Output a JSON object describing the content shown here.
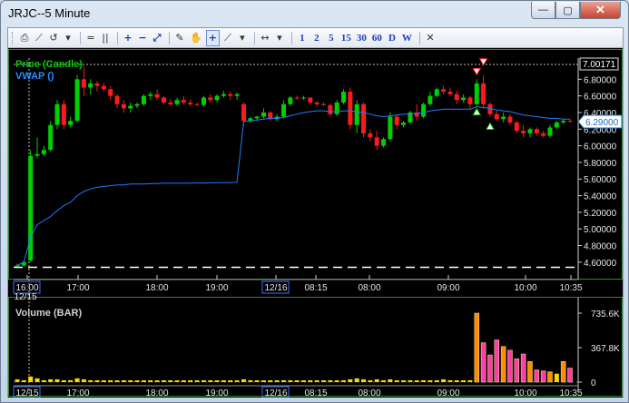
{
  "window": {
    "title": "JRJC--5 Minute",
    "minimize_label": "—",
    "maximize_label": "▢",
    "close_label": "✕"
  },
  "toolbar": {
    "items": [
      {
        "name": "print-icon",
        "glyph": "⎙"
      },
      {
        "name": "line-chart-icon",
        "glyph": "⟋"
      },
      {
        "name": "undo-icon",
        "glyph": "↺"
      },
      {
        "name": "dropdown-icon",
        "glyph": "▾"
      },
      {
        "name": "equals-icon",
        "glyph": "="
      },
      {
        "name": "pause-icon",
        "glyph": "||"
      },
      {
        "name": "zoom-in-icon",
        "glyph": "+"
      },
      {
        "name": "zoom-out-icon",
        "glyph": "−"
      },
      {
        "name": "fit-icon",
        "glyph": "⤢"
      },
      {
        "name": "draw-pen-icon",
        "glyph": "✎"
      },
      {
        "name": "hand-pan-icon",
        "glyph": "✋"
      },
      {
        "name": "crosshair-icon",
        "glyph": "+"
      },
      {
        "name": "trendline-icon",
        "glyph": "⟋"
      },
      {
        "name": "dropdown-icon",
        "glyph": "▾"
      },
      {
        "name": "scroll-both-icon",
        "glyph": "↔"
      },
      {
        "name": "dropdown-icon",
        "glyph": "▾"
      }
    ],
    "intervals": [
      "1",
      "2",
      "5",
      "15",
      "30",
      "60",
      "D",
      "W"
    ],
    "close_glyph": "✕"
  },
  "price_panel": {
    "legend_price": "Price (Candle)",
    "legend_vwap": "VWAP ()",
    "price_ticks": [
      "6.80000",
      "6.60000",
      "6.40000",
      "6.20000",
      "6.00000",
      "5.80000",
      "5.60000",
      "5.40000",
      "5.20000",
      "5.00000",
      "4.80000",
      "4.60000"
    ],
    "high_marker": "7.00171",
    "last_price": "6.29000",
    "colors": {
      "up": "#00d000",
      "down": "#ff1a1a",
      "vwap": "#1e7fff",
      "axis": "#e6e6e6",
      "legend_price": "#00d000",
      "legend_vwap": "#1e90ff",
      "last_price_bg": "#ffffff",
      "last_price_fg": "#1e6fd0"
    }
  },
  "volume_panel": {
    "legend": "Volume (BAR)",
    "ticks": [
      "735.6K",
      "367.8K",
      "0"
    ]
  },
  "time_axis": {
    "price_labels": [
      {
        "text": "16:00",
        "boxed": true
      },
      {
        "text": "17:00"
      },
      {
        "text": "18:00"
      },
      {
        "text": "19:00"
      },
      {
        "text": "12/16",
        "boxed": true
      },
      {
        "text": "08:15"
      },
      {
        "text": "08:00"
      },
      {
        "text": "09:00"
      },
      {
        "text": "10:00"
      },
      {
        "text": "10:35"
      }
    ],
    "start_date_label": "12/15",
    "volume_labels": [
      {
        "text": "12/15",
        "boxed": true
      },
      {
        "text": "17:00"
      },
      {
        "text": "18:00"
      },
      {
        "text": "19:00"
      },
      {
        "text": "12/16",
        "boxed": true
      },
      {
        "text": "08:15"
      },
      {
        "text": "08:00"
      },
      {
        "text": "09:00"
      },
      {
        "text": "10:00"
      },
      {
        "text": "10:35"
      }
    ]
  },
  "chart_data": {
    "type": "candlestick",
    "yaxis": {
      "min": 4.5,
      "max": 7.0
    },
    "volume_yaxis": {
      "min": 0,
      "max": 735600
    },
    "candles": [
      {
        "o": 4.55,
        "h": 4.58,
        "l": 4.55,
        "c": 4.56
      },
      {
        "o": 4.56,
        "h": 4.62,
        "l": 4.55,
        "c": 4.6
      },
      {
        "o": 4.62,
        "h": 5.95,
        "l": 4.6,
        "c": 5.88
      },
      {
        "o": 5.88,
        "h": 6.1,
        "l": 5.85,
        "c": 5.9
      },
      {
        "o": 5.9,
        "h": 6.0,
        "l": 5.88,
        "c": 5.95
      },
      {
        "o": 5.95,
        "h": 6.3,
        "l": 5.93,
        "c": 6.25
      },
      {
        "o": 6.25,
        "h": 6.55,
        "l": 6.2,
        "c": 6.5
      },
      {
        "o": 6.5,
        "h": 6.55,
        "l": 6.2,
        "c": 6.25
      },
      {
        "o": 6.25,
        "h": 6.35,
        "l": 6.22,
        "c": 6.3
      },
      {
        "o": 6.3,
        "h": 6.85,
        "l": 6.28,
        "c": 6.8
      },
      {
        "o": 6.8,
        "h": 6.96,
        "l": 6.6,
        "c": 6.7
      },
      {
        "o": 6.7,
        "h": 6.8,
        "l": 6.62,
        "c": 6.75
      },
      {
        "o": 6.75,
        "h": 6.78,
        "l": 6.65,
        "c": 6.72
      },
      {
        "o": 6.72,
        "h": 6.76,
        "l": 6.65,
        "c": 6.68
      },
      {
        "o": 6.68,
        "h": 6.72,
        "l": 6.55,
        "c": 6.6
      },
      {
        "o": 6.6,
        "h": 6.62,
        "l": 6.45,
        "c": 6.5
      },
      {
        "o": 6.5,
        "h": 6.55,
        "l": 6.4,
        "c": 6.45
      },
      {
        "o": 6.45,
        "h": 6.52,
        "l": 6.4,
        "c": 6.48
      },
      {
        "o": 6.48,
        "h": 6.52,
        "l": 6.45,
        "c": 6.5
      },
      {
        "o": 6.5,
        "h": 6.62,
        "l": 6.48,
        "c": 6.6
      },
      {
        "o": 6.6,
        "h": 6.65,
        "l": 6.55,
        "c": 6.62
      },
      {
        "o": 6.62,
        "h": 6.68,
        "l": 6.55,
        "c": 6.58
      },
      {
        "o": 6.58,
        "h": 6.6,
        "l": 6.5,
        "c": 6.52
      },
      {
        "o": 6.52,
        "h": 6.56,
        "l": 6.48,
        "c": 6.5
      },
      {
        "o": 6.5,
        "h": 6.58,
        "l": 6.48,
        "c": 6.55
      },
      {
        "o": 6.55,
        "h": 6.6,
        "l": 6.5,
        "c": 6.52
      },
      {
        "o": 6.52,
        "h": 6.56,
        "l": 6.48,
        "c": 6.5
      },
      {
        "o": 6.5,
        "h": 6.52,
        "l": 6.48,
        "c": 6.49
      },
      {
        "o": 6.49,
        "h": 6.6,
        "l": 6.47,
        "c": 6.58
      },
      {
        "o": 6.58,
        "h": 6.62,
        "l": 6.52,
        "c": 6.55
      },
      {
        "o": 6.55,
        "h": 6.62,
        "l": 6.52,
        "c": 6.6
      },
      {
        "o": 6.6,
        "h": 6.66,
        "l": 6.58,
        "c": 6.62
      },
      {
        "o": 6.62,
        "h": 6.65,
        "l": 6.55,
        "c": 6.6
      },
      {
        "o": 6.6,
        "h": 6.64,
        "l": 6.55,
        "c": 6.62
      },
      {
        "o": 6.5,
        "h": 6.52,
        "l": 6.25,
        "c": 6.3
      },
      {
        "o": 6.3,
        "h": 6.35,
        "l": 6.28,
        "c": 6.33
      },
      {
        "o": 6.33,
        "h": 6.36,
        "l": 6.3,
        "c": 6.35
      },
      {
        "o": 6.35,
        "h": 6.45,
        "l": 6.33,
        "c": 6.4
      },
      {
        "o": 6.4,
        "h": 6.42,
        "l": 6.3,
        "c": 6.32
      },
      {
        "o": 6.32,
        "h": 6.38,
        "l": 6.3,
        "c": 6.35
      },
      {
        "o": 6.35,
        "h": 6.55,
        "l": 6.33,
        "c": 6.5
      },
      {
        "o": 6.5,
        "h": 6.6,
        "l": 6.48,
        "c": 6.58
      },
      {
        "o": 6.58,
        "h": 6.6,
        "l": 6.55,
        "c": 6.57
      },
      {
        "o": 6.57,
        "h": 6.6,
        "l": 6.55,
        "c": 6.58
      },
      {
        "o": 6.58,
        "h": 6.58,
        "l": 6.5,
        "c": 6.52
      },
      {
        "o": 6.52,
        "h": 6.54,
        "l": 6.48,
        "c": 6.5
      },
      {
        "o": 6.5,
        "h": 6.52,
        "l": 6.48,
        "c": 6.49
      },
      {
        "o": 6.49,
        "h": 6.5,
        "l": 6.35,
        "c": 6.38
      },
      {
        "o": 6.38,
        "h": 6.55,
        "l": 6.36,
        "c": 6.52
      },
      {
        "o": 6.52,
        "h": 6.68,
        "l": 6.5,
        "c": 6.65
      },
      {
        "o": 6.65,
        "h": 6.7,
        "l": 6.2,
        "c": 6.25
      },
      {
        "o": 6.25,
        "h": 6.55,
        "l": 6.15,
        "c": 6.5
      },
      {
        "o": 6.5,
        "h": 6.52,
        "l": 6.1,
        "c": 6.15
      },
      {
        "o": 6.15,
        "h": 6.2,
        "l": 6.05,
        "c": 6.1
      },
      {
        "o": 6.1,
        "h": 6.18,
        "l": 5.95,
        "c": 6.0
      },
      {
        "o": 6.0,
        "h": 6.1,
        "l": 5.98,
        "c": 6.08
      },
      {
        "o": 6.08,
        "h": 6.4,
        "l": 6.05,
        "c": 6.35
      },
      {
        "o": 6.35,
        "h": 6.38,
        "l": 6.2,
        "c": 6.25
      },
      {
        "o": 6.25,
        "h": 6.3,
        "l": 6.22,
        "c": 6.28
      },
      {
        "o": 6.28,
        "h": 6.42,
        "l": 6.26,
        "c": 6.4
      },
      {
        "o": 6.4,
        "h": 6.5,
        "l": 6.3,
        "c": 6.35
      },
      {
        "o": 6.35,
        "h": 6.52,
        "l": 6.33,
        "c": 6.5
      },
      {
        "o": 6.5,
        "h": 6.65,
        "l": 6.48,
        "c": 6.6
      },
      {
        "o": 6.6,
        "h": 6.7,
        "l": 6.58,
        "c": 6.68
      },
      {
        "o": 6.68,
        "h": 6.72,
        "l": 6.62,
        "c": 6.65
      },
      {
        "o": 6.65,
        "h": 6.7,
        "l": 6.6,
        "c": 6.62
      },
      {
        "o": 6.62,
        "h": 6.66,
        "l": 6.5,
        "c": 6.55
      },
      {
        "o": 6.55,
        "h": 6.62,
        "l": 6.52,
        "c": 6.58
      },
      {
        "o": 6.58,
        "h": 6.6,
        "l": 6.45,
        "c": 6.5
      },
      {
        "o": 6.5,
        "h": 6.8,
        "l": 6.48,
        "c": 6.75
      },
      {
        "o": 6.75,
        "h": 6.85,
        "l": 6.45,
        "c": 6.5
      },
      {
        "o": 6.5,
        "h": 6.52,
        "l": 6.35,
        "c": 6.38
      },
      {
        "o": 6.38,
        "h": 6.42,
        "l": 6.3,
        "c": 6.32
      },
      {
        "o": 6.32,
        "h": 6.4,
        "l": 6.28,
        "c": 6.35
      },
      {
        "o": 6.35,
        "h": 6.38,
        "l": 6.25,
        "c": 6.28
      },
      {
        "o": 6.28,
        "h": 6.3,
        "l": 6.15,
        "c": 6.18
      },
      {
        "o": 6.18,
        "h": 6.25,
        "l": 6.1,
        "c": 6.15
      },
      {
        "o": 6.15,
        "h": 6.22,
        "l": 6.1,
        "c": 6.2
      },
      {
        "o": 6.2,
        "h": 6.22,
        "l": 6.12,
        "c": 6.15
      },
      {
        "o": 6.15,
        "h": 6.18,
        "l": 6.1,
        "c": 6.12
      },
      {
        "o": 6.12,
        "h": 6.25,
        "l": 6.1,
        "c": 6.22
      },
      {
        "o": 6.22,
        "h": 6.3,
        "l": 6.2,
        "c": 6.28
      },
      {
        "o": 6.28,
        "h": 6.32,
        "l": 6.26,
        "c": 6.3
      },
      {
        "o": 6.3,
        "h": 6.32,
        "l": 6.28,
        "c": 6.29
      }
    ],
    "volume": [
      30000,
      20000,
      60000,
      40000,
      20000,
      30000,
      30000,
      20000,
      20000,
      40000,
      30000,
      20000,
      20000,
      15000,
      20000,
      15000,
      10000,
      10000,
      15000,
      10000,
      10000,
      10000,
      10000,
      10000,
      10000,
      8000,
      8000,
      8000,
      10000,
      10000,
      8000,
      8000,
      8000,
      8000,
      30000,
      20000,
      15000,
      10000,
      10000,
      10000,
      20000,
      15000,
      10000,
      10000,
      8000,
      8000,
      8000,
      20000,
      15000,
      20000,
      30000,
      40000,
      30000,
      20000,
      30000,
      20000,
      30000,
      20000,
      15000,
      20000,
      15000,
      20000,
      20000,
      20000,
      30000,
      20000,
      20000,
      15000,
      20000,
      735600,
      420000,
      290000,
      450000,
      380000,
      340000,
      250000,
      300000,
      220000,
      130000,
      120000,
      110000,
      90000,
      220000,
      150000
    ],
    "vwap": [
      4.56,
      4.6,
      4.9,
      5.05,
      5.1,
      5.15,
      5.22,
      5.28,
      5.32,
      5.4,
      5.45,
      5.48,
      5.5,
      5.51,
      5.52,
      5.53,
      5.53,
      5.54,
      5.54,
      5.54,
      5.545,
      5.545,
      5.55,
      5.55,
      5.55,
      5.55,
      5.55,
      5.552,
      5.552,
      5.555,
      5.556,
      5.557,
      5.558,
      5.56,
      6.29,
      6.3,
      6.31,
      6.32,
      6.33,
      6.33,
      6.34,
      6.36,
      6.38,
      6.4,
      6.41,
      6.42,
      6.42,
      6.41,
      6.41,
      6.42,
      6.42,
      6.41,
      6.4,
      6.38,
      6.36,
      6.35,
      6.36,
      6.37,
      6.38,
      6.38,
      6.39,
      6.4,
      6.42,
      6.43,
      6.44,
      6.44,
      6.44,
      6.44,
      6.44,
      6.47,
      6.46,
      6.45,
      6.43,
      6.42,
      6.41,
      6.39,
      6.37,
      6.36,
      6.35,
      6.34,
      6.33,
      6.33,
      6.32,
      6.32
    ],
    "signal_up_indices": [
      69,
      71
    ],
    "signal_down_indices": [
      69,
      70
    ],
    "low_reference": 4.56
  }
}
